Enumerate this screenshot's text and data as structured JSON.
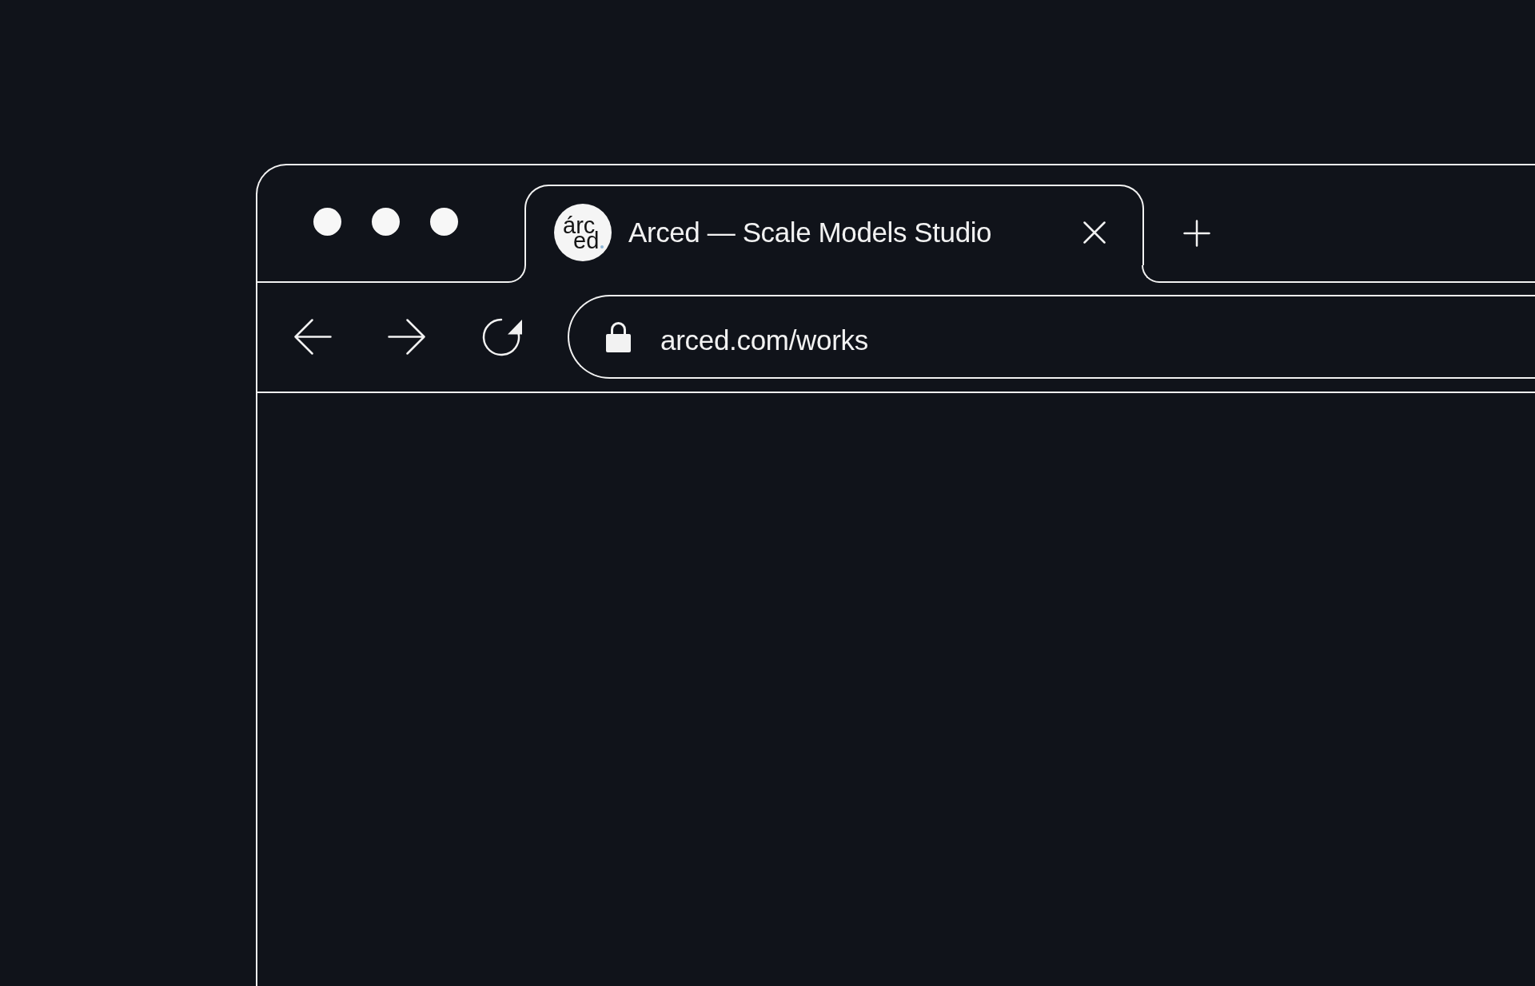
{
  "window": {
    "tabs": [
      {
        "title": "Arced — Scale Models Studio",
        "selected": true,
        "favicon": [
          "árc",
          "ed"
        ]
      }
    ]
  },
  "toolbar": {
    "address": {
      "value": "arced.com/works",
      "secure": true
    }
  }
}
